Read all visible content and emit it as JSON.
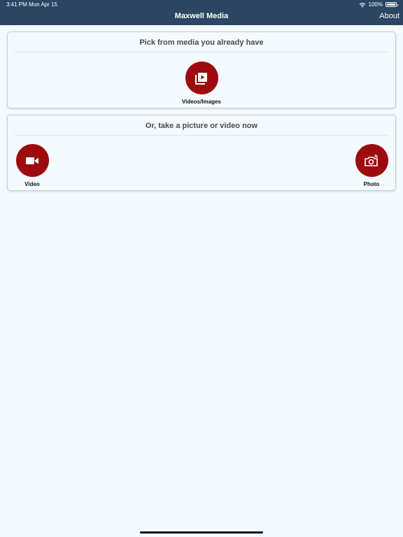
{
  "status_bar": {
    "time": "3:41 PM",
    "date": "Mon Apr 15",
    "battery": "100%"
  },
  "nav": {
    "title": "Maxwell Media",
    "about_label": "About"
  },
  "library_section": {
    "heading": "Pick from media you already have",
    "button_label": "Videos/Images"
  },
  "capture_section": {
    "heading": "Or, take a picture or video now",
    "video_label": "Video",
    "photo_label": "Photo"
  },
  "colors": {
    "nav_background": "#2c4563",
    "accent_red": "#9d0b0e",
    "page_background": "#f4faff"
  },
  "icons": {
    "library": "media-library-icon",
    "video": "video-camera-icon",
    "photo": "photo-camera-icon"
  }
}
